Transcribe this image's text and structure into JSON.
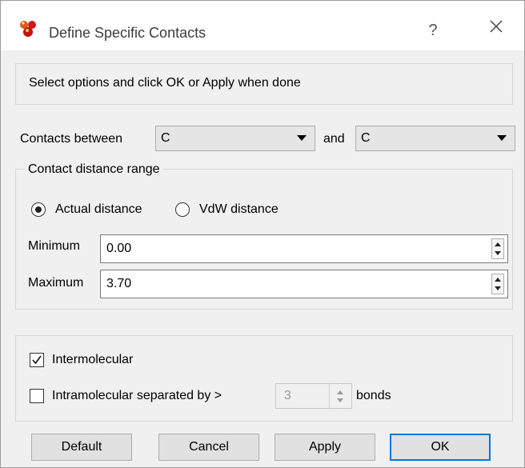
{
  "window": {
    "title": "Define Specific Contacts",
    "help_label": "?",
    "icons": {
      "app": "molecule-app-icon",
      "close": "close-icon"
    }
  },
  "instruction": "Select options and click OK or Apply when done",
  "contacts": {
    "label": "Contacts between",
    "first_value": "C",
    "and_label": "and",
    "second_value": "C"
  },
  "distance": {
    "group_title": "Contact distance range",
    "mode_options": [
      {
        "label": "Actual distance",
        "selected": true
      },
      {
        "label": "VdW distance",
        "selected": false
      }
    ],
    "minimum": {
      "label": "Minimum",
      "value": "0.00"
    },
    "maximum": {
      "label": "Maximum",
      "value": "3.70"
    }
  },
  "molecular": {
    "intermolecular": {
      "label": "Intermolecular",
      "checked": true
    },
    "intramolecular": {
      "label": "Intramolecular separated by >",
      "checked": false,
      "bonds_value": "3",
      "bonds_label": "bonds"
    }
  },
  "buttons": {
    "default": "Default",
    "cancel": "Cancel",
    "apply": "Apply",
    "ok": "OK"
  },
  "colors": {
    "focus_border": "#0078d7",
    "background": "#f0f0f0"
  }
}
